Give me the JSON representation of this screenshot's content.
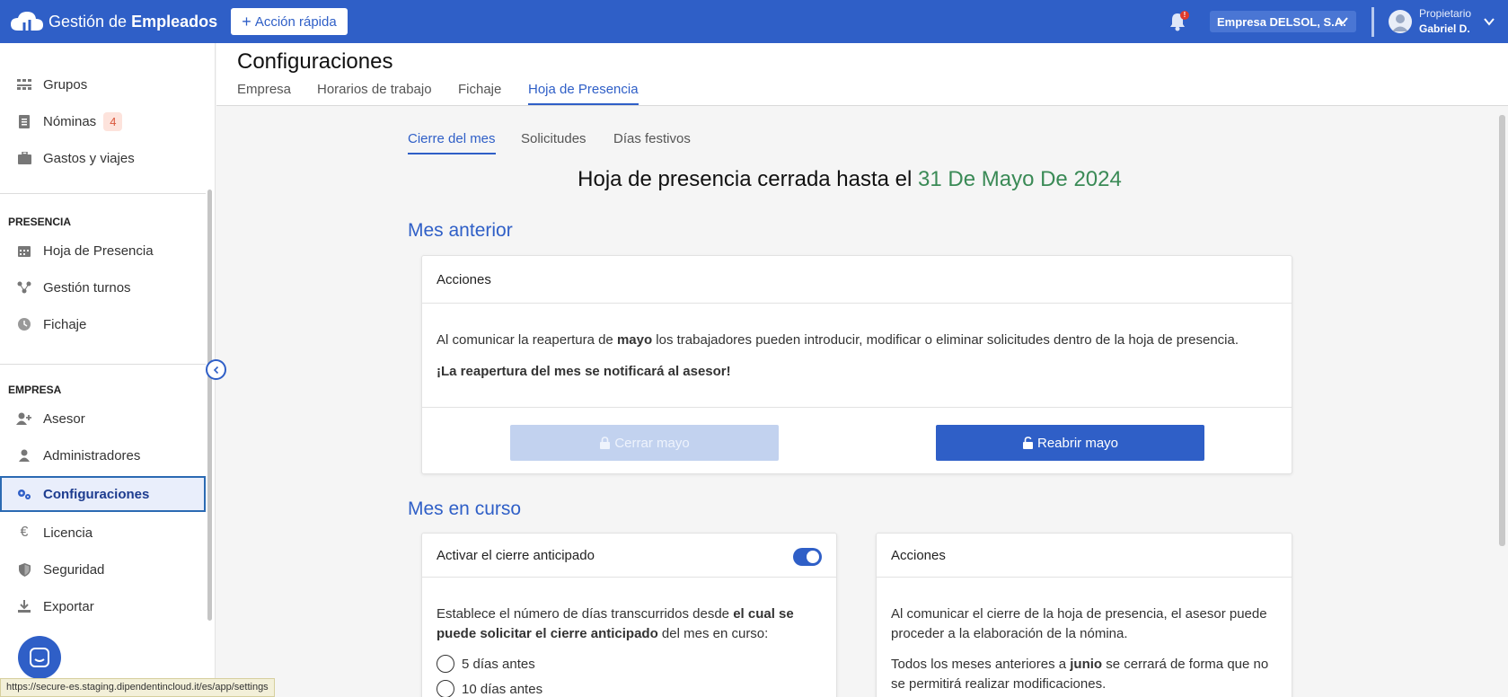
{
  "app": {
    "title_regular": "Gestión de ",
    "title_bold": "Empleados",
    "quick_action": "Acción rápida",
    "notification_badge": "!",
    "company": "Empresa DELSOL, S.A.",
    "user_role": "Propietario",
    "user_name": "Gabriel D."
  },
  "sidebar": {
    "top_items": [
      {
        "label": "Grupos",
        "icon": "groups-icon"
      },
      {
        "label": "Nóminas",
        "icon": "payroll-icon",
        "badge": "4"
      },
      {
        "label": "Gastos y viajes",
        "icon": "briefcase-icon"
      }
    ],
    "presence_title": "PRESENCIA",
    "presence_items": [
      {
        "label": "Hoja de Presencia",
        "icon": "calendar-icon"
      },
      {
        "label": "Gestión turnos",
        "icon": "shifts-icon"
      },
      {
        "label": "Fichaje",
        "icon": "clock-icon"
      }
    ],
    "company_title": "EMPRESA",
    "company_items": [
      {
        "label": "Asesor",
        "icon": "add-user-icon"
      },
      {
        "label": "Administradores",
        "icon": "admin-icon"
      },
      {
        "label": "Configuraciones",
        "icon": "gears-icon",
        "active": true
      },
      {
        "label": "Licencia",
        "icon": "euro-icon"
      },
      {
        "label": "Seguridad",
        "icon": "shield-icon"
      },
      {
        "label": "Exportar",
        "icon": "download-icon"
      }
    ]
  },
  "status_url": "https://secure-es.staging.dipendentincloud.it/es/app/settings",
  "page": {
    "title": "Configuraciones",
    "tabs": [
      "Empresa",
      "Horarios de trabajo",
      "Fichaje",
      "Hoja de Presencia"
    ],
    "active_tab": "Hoja de Presencia",
    "subtabs": [
      "Cierre del mes",
      "Solicitudes",
      "Días festivos"
    ],
    "active_subtab": "Cierre del mes",
    "headline_prefix": "Hoja de presencia cerrada hasta el ",
    "headline_date": "31 De Mayo De 2024"
  },
  "previous_month": {
    "title": "Mes anterior",
    "card_title": "Acciones",
    "text_before": "Al comunicar la reapertura de ",
    "text_bold": "mayo",
    "text_after": " los trabajadores pueden introducir, modificar o eliminar solicitudes dentro de la hoja de presencia.",
    "warning": "¡La reapertura del mes se notificará al asesor!",
    "close_button": "Cerrar mayo",
    "reopen_button": "Reabrir mayo"
  },
  "current_month": {
    "title": "Mes en curso",
    "early_close_label": "Activar el cierre anticipado",
    "early_close_enabled": true,
    "desc_before": "Establece el número de días transcurridos desde ",
    "desc_bold": "el cual se puede solicitar el cierre anticipado",
    "desc_after": " del mes en curso:",
    "options": [
      "5 días antes",
      "10 días antes"
    ],
    "actions_title": "Acciones",
    "actions_text1": "Al comunicar el cierre de la hoja de presencia, el asesor puede proceder a la elaboración de la nómina.",
    "actions_text2_before": "Todos los meses anteriores a ",
    "actions_text2_bold": "junio",
    "actions_text2_after": " se cerrará de forma que no se permitirá realizar modificaciones."
  },
  "colors": {
    "primary": "#2f5fc7",
    "date_green": "#3a8a56",
    "badge_bg": "#fde3dc",
    "badge_text": "#d9573c"
  }
}
